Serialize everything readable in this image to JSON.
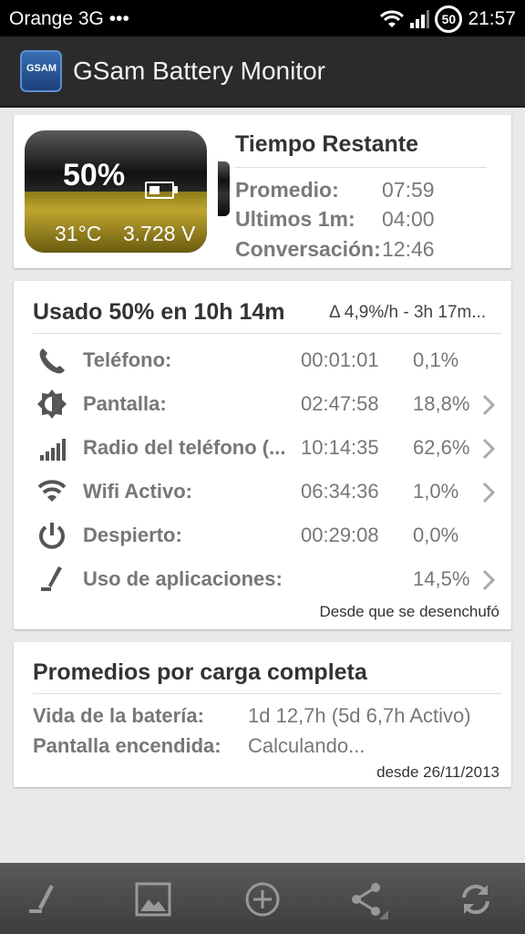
{
  "status_bar": {
    "carrier": "Orange 3G",
    "dots": "•••",
    "battery_level": "50",
    "time": "21:57"
  },
  "app_bar": {
    "title": "GSam Battery Monitor",
    "logo_text": "GSAM"
  },
  "battery_card": {
    "percent": "50%",
    "level": 0.5,
    "temperature": "31°C",
    "voltage": "3.728 V",
    "time_remaining": {
      "title": "Tiempo Restante",
      "rows": [
        {
          "label": "Promedio:",
          "value": "07:59"
        },
        {
          "label": "Ultimos 1m:",
          "value": "04:00"
        },
        {
          "label": "Conversación:",
          "value": "12:46"
        }
      ]
    }
  },
  "usage_card": {
    "title": "Usado 50% en 10h 14m",
    "rate": "Δ 4,9%/h - 3h 17m...",
    "rows": [
      {
        "icon": "phone-icon",
        "name": "Teléfono:",
        "time": "00:01:01",
        "percent": "0,1%",
        "chevron": false
      },
      {
        "icon": "screen-brightness-icon",
        "name": "Pantalla:",
        "time": "02:47:58",
        "percent": "18,8%",
        "chevron": true
      },
      {
        "icon": "signal-bars-icon",
        "name": "Radio del teléfono (...",
        "time": "10:14:35",
        "percent": "62,6%",
        "chevron": true
      },
      {
        "icon": "wifi-icon",
        "name": "Wifi Activo:",
        "time": "06:34:36",
        "percent": "1,0%",
        "chevron": true
      },
      {
        "icon": "power-icon",
        "name": "Despierto:",
        "time": "00:29:08",
        "percent": "0,0%",
        "chevron": false
      },
      {
        "icon": "app-usage-icon",
        "name": "Uso de aplicaciones:",
        "time": "",
        "percent": "14,5%",
        "chevron": true
      }
    ],
    "footer": "Desde que se desenchufó"
  },
  "averages_card": {
    "title": "Promedios por carga completa",
    "rows": [
      {
        "label": "Vida de la batería:",
        "value": "1d 12,7h (5d 6,7h Activo)"
      },
      {
        "label": "Pantalla encendida:",
        "value": "Calculando..."
      }
    ],
    "footer": "desde 26/11/2013"
  },
  "bottom_bar": {
    "buttons": [
      "app-usage-icon",
      "image-icon",
      "add-circle-icon",
      "share-icon",
      "refresh-icon"
    ]
  }
}
